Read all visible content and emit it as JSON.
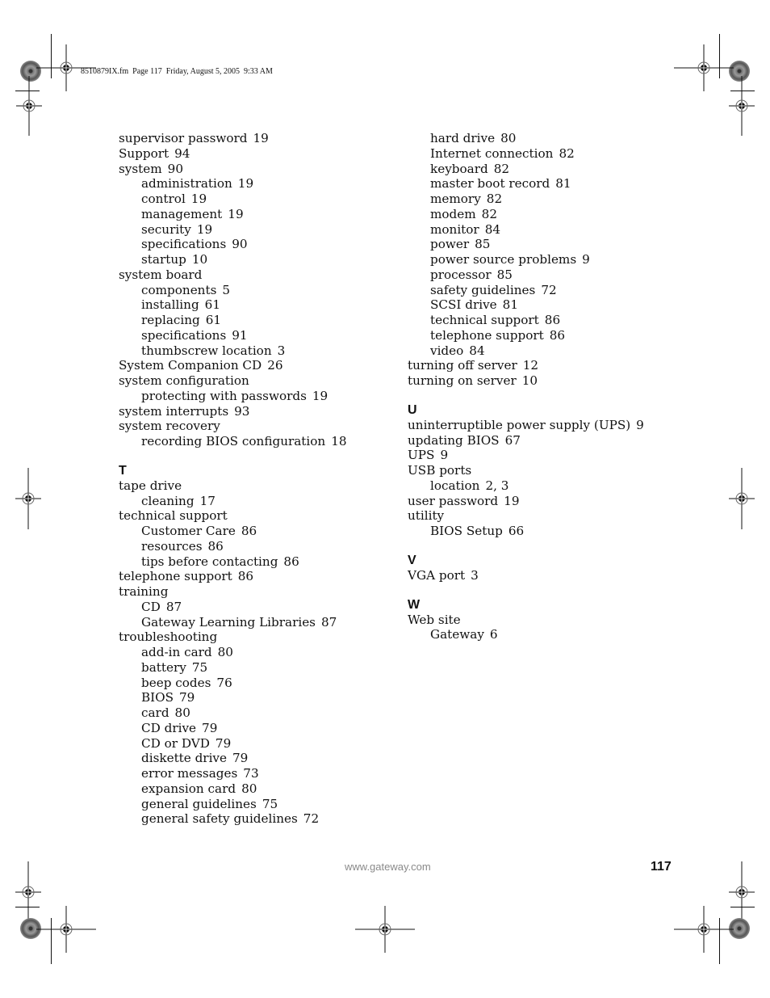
{
  "slug": "8510879IX.fm  Page 117  Friday, August 5, 2005  9:33 AM",
  "left_column": [
    {
      "type": "entry",
      "level": 0,
      "term": "supervisor password",
      "pages": "19"
    },
    {
      "type": "entry",
      "level": 0,
      "term": "Support",
      "pages": "94"
    },
    {
      "type": "entry",
      "level": 0,
      "term": "system",
      "pages": "90"
    },
    {
      "type": "entry",
      "level": 1,
      "term": "administration",
      "pages": "19"
    },
    {
      "type": "entry",
      "level": 1,
      "term": "control",
      "pages": "19"
    },
    {
      "type": "entry",
      "level": 1,
      "term": "management",
      "pages": "19"
    },
    {
      "type": "entry",
      "level": 1,
      "term": "security",
      "pages": "19"
    },
    {
      "type": "entry",
      "level": 1,
      "term": "specifications",
      "pages": "90"
    },
    {
      "type": "entry",
      "level": 1,
      "term": "startup",
      "pages": "10"
    },
    {
      "type": "entry",
      "level": 0,
      "term": "system board",
      "pages": ""
    },
    {
      "type": "entry",
      "level": 1,
      "term": "components",
      "pages": "5"
    },
    {
      "type": "entry",
      "level": 1,
      "term": "installing",
      "pages": "61"
    },
    {
      "type": "entry",
      "level": 1,
      "term": "replacing",
      "pages": "61"
    },
    {
      "type": "entry",
      "level": 1,
      "term": "specifications",
      "pages": "91"
    },
    {
      "type": "entry",
      "level": 1,
      "term": "thumbscrew location",
      "pages": "3"
    },
    {
      "type": "entry",
      "level": 0,
      "term": "System Companion CD",
      "pages": "26"
    },
    {
      "type": "entry",
      "level": 0,
      "term": "system configuration",
      "pages": ""
    },
    {
      "type": "entry",
      "level": 1,
      "term": "protecting with passwords",
      "pages": "19"
    },
    {
      "type": "entry",
      "level": 0,
      "term": "system interrupts",
      "pages": "93"
    },
    {
      "type": "entry",
      "level": 0,
      "term": "system recovery",
      "pages": ""
    },
    {
      "type": "entry",
      "level": 1,
      "term": "recording BIOS configuration",
      "pages": "18"
    },
    {
      "type": "letter",
      "term": "T"
    },
    {
      "type": "entry",
      "level": 0,
      "term": "tape drive",
      "pages": ""
    },
    {
      "type": "entry",
      "level": 1,
      "term": "cleaning",
      "pages": "17"
    },
    {
      "type": "entry",
      "level": 0,
      "term": "technical support",
      "pages": ""
    },
    {
      "type": "entry",
      "level": 1,
      "term": "Customer Care",
      "pages": "86"
    },
    {
      "type": "entry",
      "level": 1,
      "term": "resources",
      "pages": "86"
    },
    {
      "type": "entry",
      "level": 1,
      "term": "tips before contacting",
      "pages": "86"
    },
    {
      "type": "entry",
      "level": 0,
      "term": "telephone support",
      "pages": "86"
    },
    {
      "type": "entry",
      "level": 0,
      "term": "training",
      "pages": ""
    },
    {
      "type": "entry",
      "level": 1,
      "term": "CD",
      "pages": "87"
    },
    {
      "type": "entry",
      "level": 1,
      "term": "Gateway Learning Libraries",
      "pages": "87"
    },
    {
      "type": "entry",
      "level": 0,
      "term": "troubleshooting",
      "pages": ""
    },
    {
      "type": "entry",
      "level": 1,
      "term": "add-in card",
      "pages": "80"
    },
    {
      "type": "entry",
      "level": 1,
      "term": "battery",
      "pages": "75"
    },
    {
      "type": "entry",
      "level": 1,
      "term": "beep codes",
      "pages": "76"
    },
    {
      "type": "entry",
      "level": 1,
      "term": "BIOS",
      "pages": "79"
    },
    {
      "type": "entry",
      "level": 1,
      "term": "card",
      "pages": "80"
    },
    {
      "type": "entry",
      "level": 1,
      "term": "CD drive",
      "pages": "79"
    },
    {
      "type": "entry",
      "level": 1,
      "term": "CD or DVD",
      "pages": "79"
    },
    {
      "type": "entry",
      "level": 1,
      "term": "diskette drive",
      "pages": "79"
    },
    {
      "type": "entry",
      "level": 1,
      "term": "error messages",
      "pages": "73"
    },
    {
      "type": "entry",
      "level": 1,
      "term": "expansion card",
      "pages": "80"
    },
    {
      "type": "entry",
      "level": 1,
      "term": "general guidelines",
      "pages": "75"
    },
    {
      "type": "entry",
      "level": 1,
      "term": "general safety guidelines",
      "pages": "72"
    }
  ],
  "right_column": [
    {
      "type": "entry",
      "level": 1,
      "term": "hard drive",
      "pages": "80"
    },
    {
      "type": "entry",
      "level": 1,
      "term": "Internet connection",
      "pages": "82"
    },
    {
      "type": "entry",
      "level": 1,
      "term": "keyboard",
      "pages": "82"
    },
    {
      "type": "entry",
      "level": 1,
      "term": "master boot record",
      "pages": "81"
    },
    {
      "type": "entry",
      "level": 1,
      "term": "memory",
      "pages": "82"
    },
    {
      "type": "entry",
      "level": 1,
      "term": "modem",
      "pages": "82"
    },
    {
      "type": "entry",
      "level": 1,
      "term": "monitor",
      "pages": "84"
    },
    {
      "type": "entry",
      "level": 1,
      "term": "power",
      "pages": "85"
    },
    {
      "type": "entry",
      "level": 1,
      "term": "power source problems",
      "pages": "9"
    },
    {
      "type": "entry",
      "level": 1,
      "term": "processor",
      "pages": "85"
    },
    {
      "type": "entry",
      "level": 1,
      "term": "safety guidelines",
      "pages": "72"
    },
    {
      "type": "entry",
      "level": 1,
      "term": "SCSI drive",
      "pages": "81"
    },
    {
      "type": "entry",
      "level": 1,
      "term": "technical support",
      "pages": "86"
    },
    {
      "type": "entry",
      "level": 1,
      "term": "telephone support",
      "pages": "86"
    },
    {
      "type": "entry",
      "level": 1,
      "term": "video",
      "pages": "84"
    },
    {
      "type": "entry",
      "level": 0,
      "term": "turning off server",
      "pages": "12"
    },
    {
      "type": "entry",
      "level": 0,
      "term": "turning on server",
      "pages": "10"
    },
    {
      "type": "letter",
      "term": "U"
    },
    {
      "type": "entry",
      "level": 0,
      "term": "uninterruptible power supply (UPS)",
      "pages": "9"
    },
    {
      "type": "entry",
      "level": 0,
      "term": "updating BIOS",
      "pages": "67"
    },
    {
      "type": "entry",
      "level": 0,
      "term": "UPS",
      "pages": "9"
    },
    {
      "type": "entry",
      "level": 0,
      "term": "USB ports",
      "pages": ""
    },
    {
      "type": "entry",
      "level": 1,
      "term": "location",
      "pages": "2, 3"
    },
    {
      "type": "entry",
      "level": 0,
      "term": "user password",
      "pages": "19"
    },
    {
      "type": "entry",
      "level": 0,
      "term": "utility",
      "pages": ""
    },
    {
      "type": "entry",
      "level": 1,
      "term": "BIOS Setup",
      "pages": "66"
    },
    {
      "type": "letter",
      "term": "V"
    },
    {
      "type": "entry",
      "level": 0,
      "term": "VGA port",
      "pages": "3"
    },
    {
      "type": "letter",
      "term": "W"
    },
    {
      "type": "entry",
      "level": 0,
      "term": "Web site",
      "pages": ""
    },
    {
      "type": "entry",
      "level": 1,
      "term": "Gateway",
      "pages": "6"
    }
  ],
  "footer": {
    "url": "www.gateway.com",
    "page_number": "117"
  }
}
